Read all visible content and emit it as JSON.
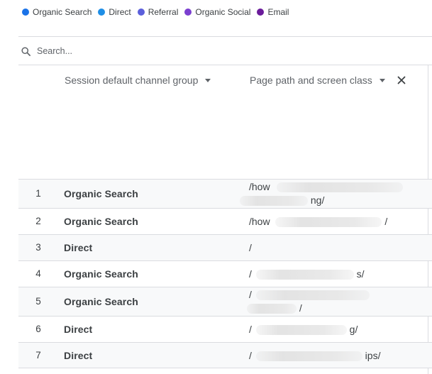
{
  "legend": [
    {
      "label": "Organic Search",
      "color": "#1a73e8",
      "icon": "legend-dot"
    },
    {
      "label": "Direct",
      "color": "#1e8ee6",
      "icon": "legend-dot"
    },
    {
      "label": "Referral",
      "color": "#5b5fdb",
      "icon": "legend-dot"
    },
    {
      "label": "Organic Social",
      "color": "#7b3fd0",
      "icon": "legend-dot"
    },
    {
      "label": "Email",
      "color": "#6a1b9a",
      "icon": "legend-dot"
    }
  ],
  "search": {
    "placeholder": "Search..."
  },
  "columns": {
    "dimension1": "Session default channel group",
    "dimension2": "Page path and screen class"
  },
  "rows": [
    {
      "num": "1",
      "channel": "Organic Search",
      "path_line1": "/how",
      "path_line2": "ng/"
    },
    {
      "num": "2",
      "channel": "Organic Search",
      "path_line1": "/how",
      "path_line2": "/"
    },
    {
      "num": "3",
      "channel": "Direct",
      "path_line1": "/",
      "path_line2": ""
    },
    {
      "num": "4",
      "channel": "Organic Search",
      "path_line1": "/",
      "path_line2": "s/"
    },
    {
      "num": "5",
      "channel": "Organic Search",
      "path_line1": "/",
      "path_line2": "/"
    },
    {
      "num": "6",
      "channel": "Direct",
      "path_line1": "/",
      "path_line2": "g/"
    },
    {
      "num": "7",
      "channel": "Direct",
      "path_line1": "/",
      "path_line2": "ips/"
    }
  ]
}
